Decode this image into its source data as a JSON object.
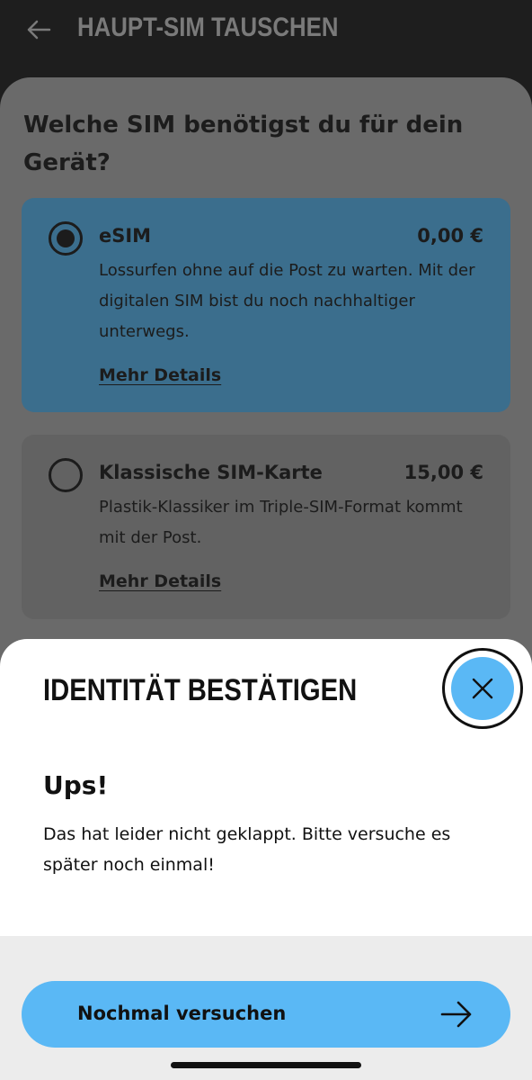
{
  "header": {
    "title": "HAUPT-SIM TAUSCHEN",
    "back_icon": "arrow-left-icon"
  },
  "main": {
    "question": "Welche SIM benötigst du für dein Gerät?",
    "options": [
      {
        "name": "eSIM",
        "price": "0,00 €",
        "description": "Lossurfen ohne auf die Post zu warten. Mit der digitalen SIM bist du noch nachhaltiger unterwegs.",
        "link": "Mehr Details",
        "selected": true
      },
      {
        "name": "Klassische SIM-Karte",
        "price": "15,00 €",
        "description": "Plastik-Klassiker im Triple-SIM-Format kommt mit der Post.",
        "link": "Mehr Details",
        "selected": false
      }
    ]
  },
  "sheet": {
    "title": "IDENTITÄT BESTÄTIGEN",
    "close_icon": "close-icon",
    "heading": "Ups!",
    "message": "Das hat leider nicht geklappt. Bitte versuche es später noch einmal!",
    "retry_label": "Nochmal versuchen",
    "retry_icon": "arrow-right-icon"
  },
  "colors": {
    "accent": "#5ab8f5",
    "header_bg": "#1e1e1e",
    "overlay_bg": "#6a6a6a",
    "selected_option_bg": "#3b6e8d",
    "footer_bg": "#ececec"
  }
}
